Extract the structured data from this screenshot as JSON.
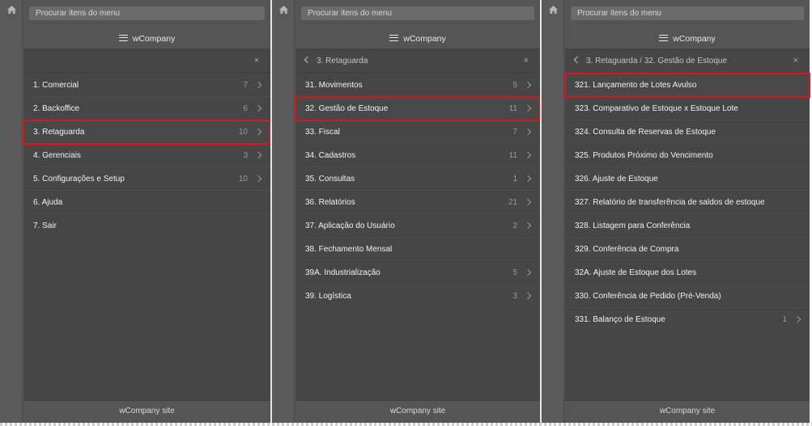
{
  "search_placeholder": "Procurar itens do menu",
  "brand": "wCompany",
  "footer": "wCompany site",
  "colors": {
    "panel": "#555555",
    "list": "#464646",
    "highlight": "#d7191c",
    "search": "#6b6b6b"
  },
  "panels": [
    {
      "back_label": "",
      "items": [
        {
          "label": "1. Comercial",
          "count": "7",
          "chevron": true
        },
        {
          "label": "2. Backoffice",
          "count": "6",
          "chevron": true
        },
        {
          "label": "3. Retaguarda",
          "count": "10",
          "chevron": true
        },
        {
          "label": "4. Gerenciais",
          "count": "3",
          "chevron": true
        },
        {
          "label": "5. Configurações e Setup",
          "count": "10",
          "chevron": true
        },
        {
          "label": "6. Ajuda",
          "count": "",
          "chevron": false
        },
        {
          "label": "7. Sair",
          "count": "",
          "chevron": false
        }
      ]
    },
    {
      "back_label": "3. Retaguarda",
      "items": [
        {
          "label": "31. Movimentos",
          "count": "5",
          "chevron": true
        },
        {
          "label": "32. Gestão de Estoque",
          "count": "11",
          "chevron": true
        },
        {
          "label": "33. Fiscal",
          "count": "7",
          "chevron": true
        },
        {
          "label": "34. Cadastros",
          "count": "11",
          "chevron": true
        },
        {
          "label": "35. Consultas",
          "count": "1",
          "chevron": true
        },
        {
          "label": "36. Relatórios",
          "count": "21",
          "chevron": true
        },
        {
          "label": "37. Aplicação do Usuário",
          "count": "2",
          "chevron": true
        },
        {
          "label": "38. Fechamento Mensal",
          "count": "",
          "chevron": false
        },
        {
          "label": "39A. Industrialização",
          "count": "5",
          "chevron": true
        },
        {
          "label": "39. Logística",
          "count": "3",
          "chevron": true
        }
      ]
    },
    {
      "back_label": "3. Retaguarda / 32. Gestão de Estoque",
      "items": [
        {
          "label": "321. Lançamento de Lotes Avulso",
          "count": "",
          "chevron": false
        },
        {
          "label": "323. Comparativo de Estoque x Estoque Lote",
          "count": "",
          "chevron": false
        },
        {
          "label": "324. Consulta de Reservas de Estoque",
          "count": "",
          "chevron": false
        },
        {
          "label": "325. Produtos Próximo do Vencimento",
          "count": "",
          "chevron": false
        },
        {
          "label": "326. Ajuste de Estoque",
          "count": "",
          "chevron": false
        },
        {
          "label": "327. Relatório de transferência de saldos de estoque",
          "count": "",
          "chevron": false
        },
        {
          "label": "328. Listagem para Conferência",
          "count": "",
          "chevron": false
        },
        {
          "label": "329. Conferência de Compra",
          "count": "",
          "chevron": false
        },
        {
          "label": "32A. Ajuste de Estoque dos Lotes",
          "count": "",
          "chevron": false
        },
        {
          "label": "330. Conferência de Pedido (Pré-Venda)",
          "count": "",
          "chevron": false
        },
        {
          "label": "331. Balanço de Estoque",
          "count": "1",
          "chevron": true
        }
      ]
    }
  ]
}
